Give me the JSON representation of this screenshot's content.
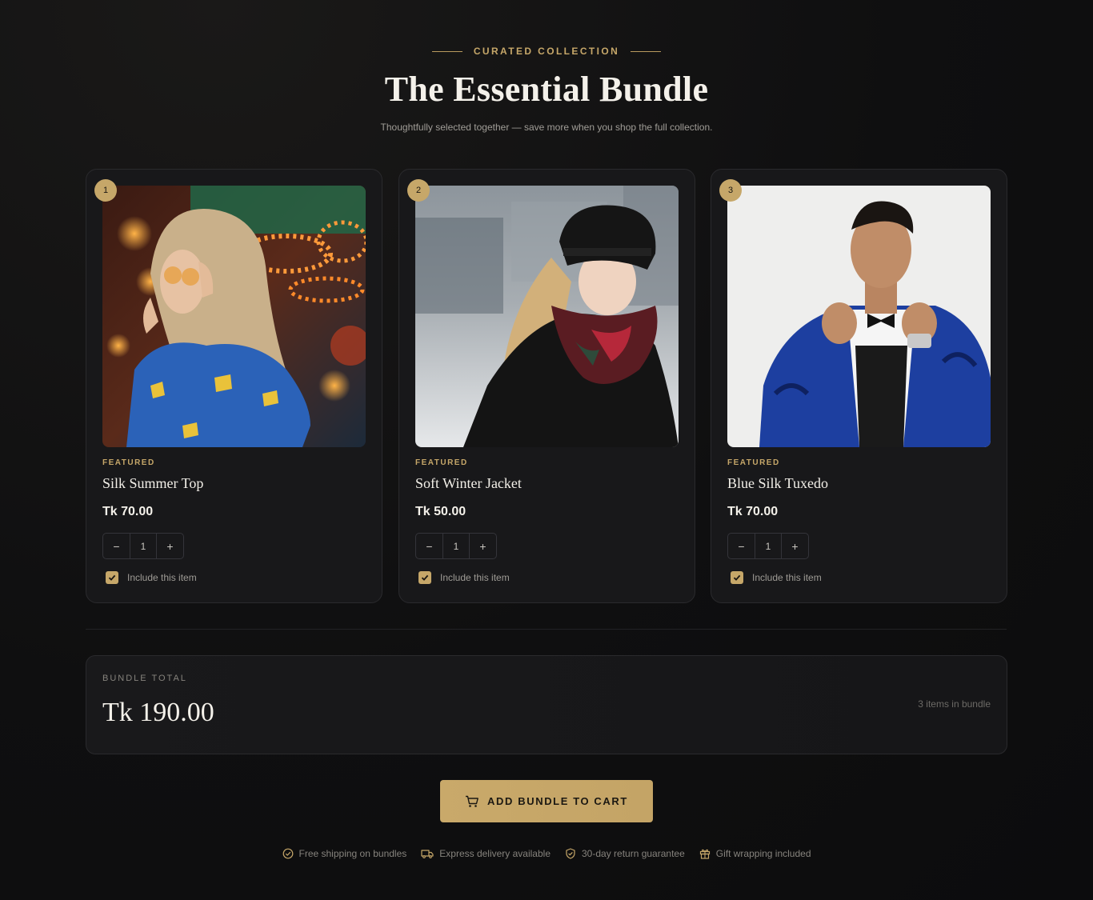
{
  "header": {
    "eyebrow": "CURATED COLLECTION",
    "title": "The Essential Bundle",
    "subtitle": "Thoughtfully selected together — save more when you shop the full collection."
  },
  "products": [
    {
      "index": "1",
      "tag": "FEATURED",
      "name": "Silk Summer Top",
      "price": "Tk 70.00",
      "qty": "1",
      "include_label": "Include this item",
      "included": true
    },
    {
      "index": "2",
      "tag": "FEATURED",
      "name": "Soft Winter Jacket",
      "price": "Tk 50.00",
      "qty": "1",
      "include_label": "Include this item",
      "included": true
    },
    {
      "index": "3",
      "tag": "FEATURED",
      "name": "Blue Silk Tuxedo",
      "price": "Tk 70.00",
      "qty": "1",
      "include_label": "Include this item",
      "included": true
    }
  ],
  "stepper": {
    "minus": "−",
    "plus": "+"
  },
  "total": {
    "label": "BUNDLE TOTAL",
    "amount": "Tk 190.00",
    "count": "3 items in bundle"
  },
  "cta": {
    "label": "ADD BUNDLE TO CART",
    "icon": "cart-icon"
  },
  "perks": [
    {
      "icon": "check-circle-icon",
      "label": "Free shipping on bundles"
    },
    {
      "icon": "truck-icon",
      "label": "Express delivery available"
    },
    {
      "icon": "shield-check-icon",
      "label": "30-day return guarantee"
    },
    {
      "icon": "gift-icon",
      "label": "Gift wrapping included"
    }
  ],
  "colors": {
    "accent": "#c6a769",
    "background": "#0e0e0f",
    "card": "#18181a"
  }
}
